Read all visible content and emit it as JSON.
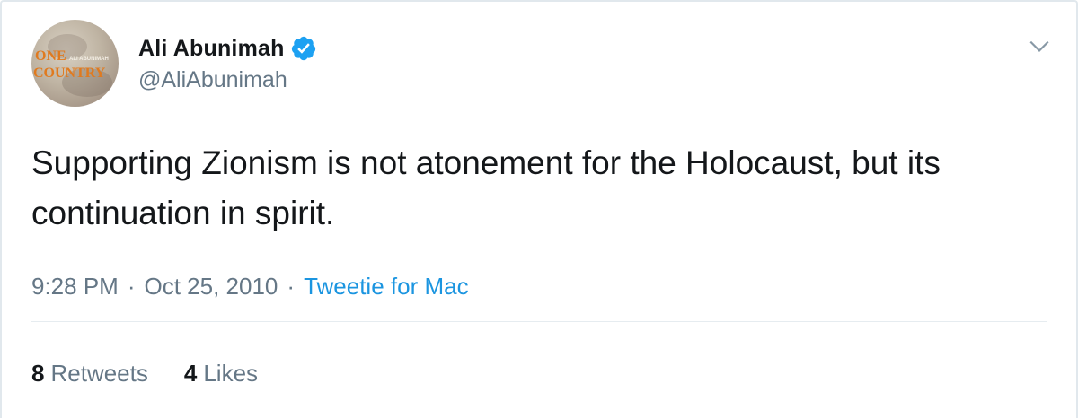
{
  "author": {
    "display_name": "Ali Abunimah",
    "handle": "@AliAbunimah",
    "verified": true,
    "avatar_text": {
      "line1": "ONE",
      "line2": "COUNTRY",
      "small": "ALI ABUNIMAH"
    }
  },
  "tweet": {
    "text": "Supporting Zionism is not atonement for the Holocaust, but its continuation in spirit.",
    "time": "9:28 PM",
    "separator": "·",
    "date": "Oct 25, 2010",
    "source": "Tweetie for Mac"
  },
  "stats": {
    "retweets_count": "8",
    "retweets_label": "Retweets",
    "likes_count": "4",
    "likes_label": "Likes"
  },
  "icons": {
    "verified": "verified-badge-icon",
    "more": "chevron-down-icon"
  },
  "colors": {
    "text_primary": "#14171a",
    "text_secondary": "#657786",
    "link": "#1b95e0",
    "verified": "#1da1f2",
    "border": "#e1e8ed"
  }
}
